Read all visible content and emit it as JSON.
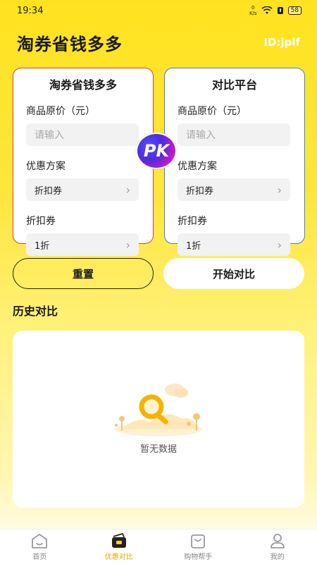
{
  "status": {
    "time": "19:34",
    "net_speed_top": "0",
    "net_speed_bottom": "K/s",
    "battery": "58"
  },
  "header": {
    "title": "淘券省钱多多",
    "user_id": "ID:jplf"
  },
  "compare": {
    "left": {
      "title": "淘券省钱多多",
      "price_label": "商品原价（元）",
      "price_placeholder": "请输入",
      "scheme_label": "优惠方案",
      "scheme_value": "折扣券",
      "coupon_label": "折扣券",
      "coupon_value": "1折"
    },
    "right": {
      "title": "对比平台",
      "price_label": "商品原价（元）",
      "price_placeholder": "请输入",
      "scheme_label": "优惠方案",
      "scheme_value": "折扣券",
      "coupon_label": "折扣券",
      "coupon_value": "1折"
    },
    "pk_badge": "PK"
  },
  "actions": {
    "reset_label": "重置",
    "start_label": "开始对比"
  },
  "history": {
    "title": "历史对比",
    "empty_text": "暂无数据"
  },
  "tabs": [
    {
      "label": "首页",
      "icon": "home-icon",
      "active": false
    },
    {
      "label": "优惠对比",
      "icon": "wallet-icon",
      "active": true
    },
    {
      "label": "购物帮手",
      "icon": "shopping-bag-icon",
      "active": false
    },
    {
      "label": "我的",
      "icon": "user-icon",
      "active": false
    }
  ],
  "colors": {
    "accent_yellow": "#FFE21F",
    "left_border": "#E0383E",
    "right_border": "#3B7FE0",
    "active_tab": "#E0A800"
  }
}
